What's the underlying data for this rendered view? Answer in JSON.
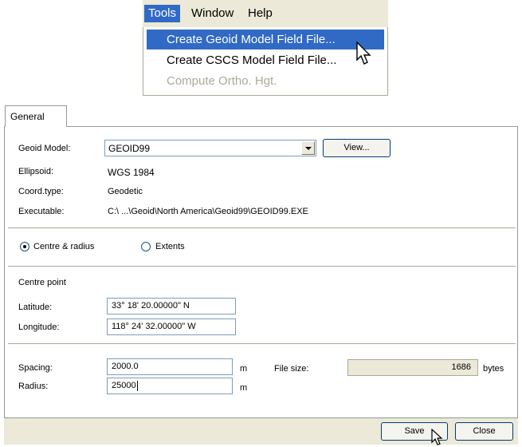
{
  "menu": {
    "items": [
      "Tools",
      "Window",
      "Help"
    ],
    "active_index": 0,
    "dropdown": [
      {
        "label": "Create Geoid Model Field File...",
        "state": "highlighted"
      },
      {
        "label": "Create CSCS Model Field File...",
        "state": "normal"
      },
      {
        "label": "Compute Ortho. Hgt.",
        "state": "disabled"
      }
    ]
  },
  "dialog": {
    "tab": "General",
    "geoid_model": {
      "label": "Geoid Model:",
      "value": "GEOID99",
      "view_button": "View..."
    },
    "ellipsoid": {
      "label": "Ellipsoid:",
      "value": "WGS 1984"
    },
    "coord_type": {
      "label": "Coord.type:",
      "value": "Geodetic"
    },
    "executable": {
      "label": "Executable:",
      "value": "C:\\ ...\\Geoid\\North America\\Geoid99\\GEOID99.EXE"
    },
    "mode": {
      "options": [
        "Centre & radius",
        "Extents"
      ],
      "selected": "Centre & radius"
    },
    "centre_point": {
      "heading": "Centre point",
      "latitude_label": "Latitude:",
      "latitude_value": "33° 18' 20.00000\" N",
      "longitude_label": "Longitude:",
      "longitude_value": "118° 24' 32.00000\" W"
    },
    "spacing": {
      "label": "Spacing:",
      "value": "2000.0",
      "unit": "m"
    },
    "radius": {
      "label": "Radius:",
      "value": "25000",
      "unit": "m"
    },
    "file_size": {
      "label": "File size:",
      "value": "1686",
      "unit": "bytes"
    },
    "buttons": {
      "save": "Save",
      "close": "Close"
    }
  },
  "colors": {
    "highlight": "#316ac5",
    "dialog_bg": "#ece9d8",
    "disabled_text": "#aca899"
  }
}
